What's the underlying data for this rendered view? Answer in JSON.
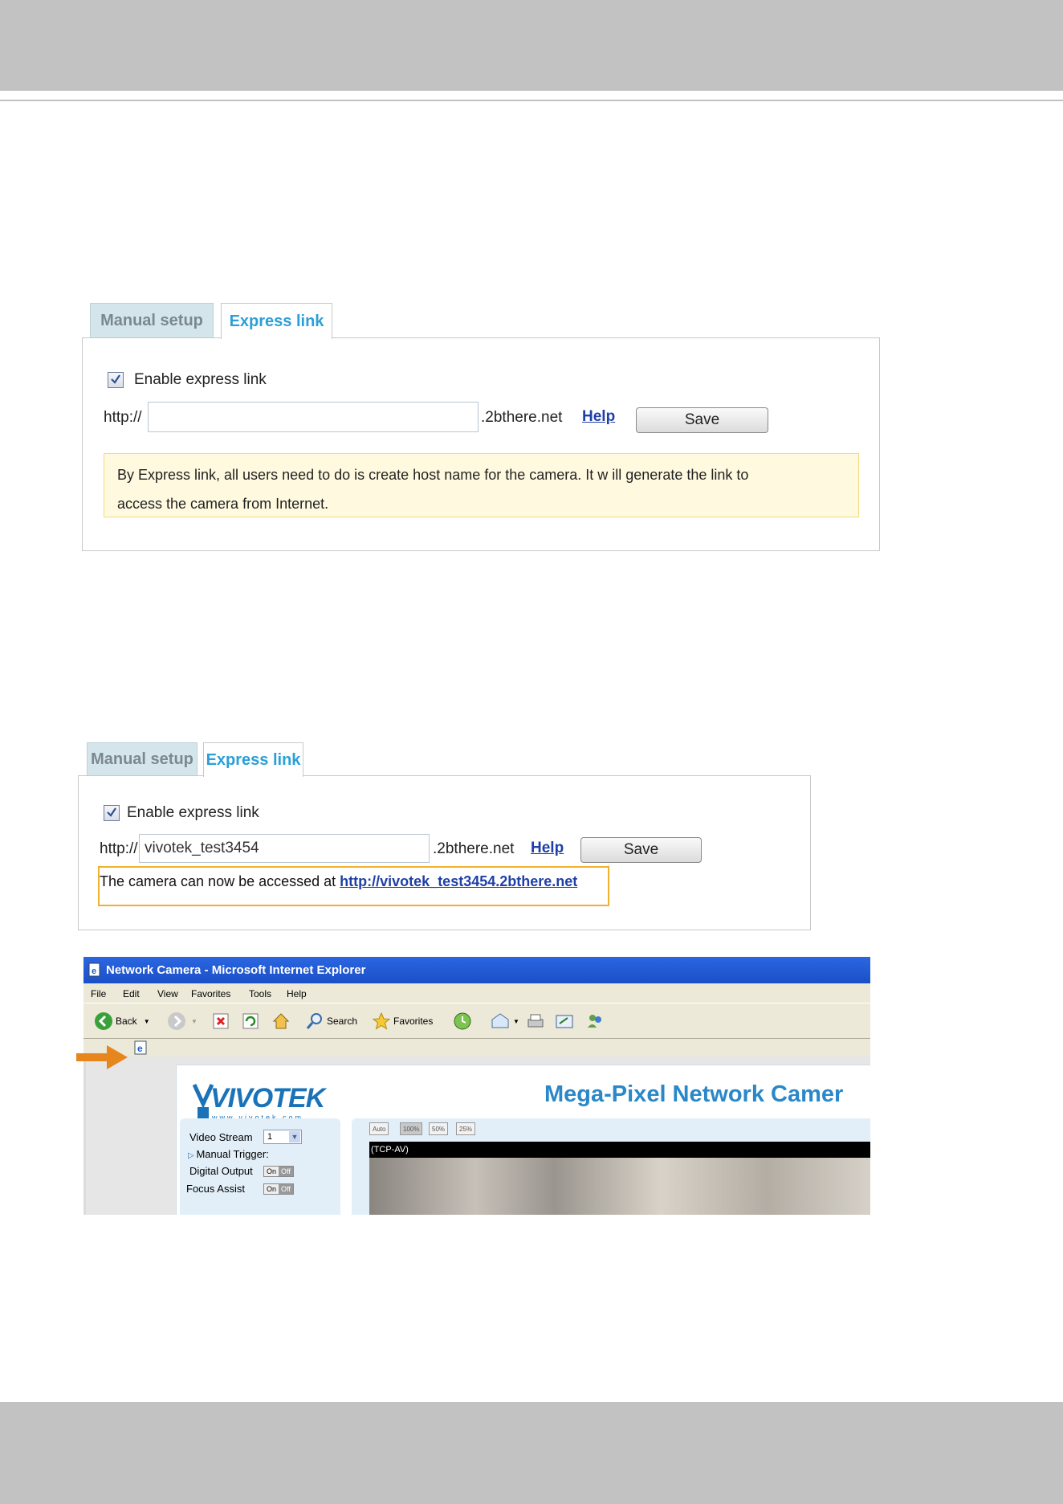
{
  "panel1": {
    "tabs": [
      "Manual setup",
      "Express link"
    ],
    "enable_label": "Enable express link",
    "enabled": true,
    "prefix": "http://",
    "hostname_value": "",
    "suffix": ".2bthere.net",
    "help_label": "Help",
    "save_label": "Save",
    "note_line1": "By Express link, all users need to do is create host name for the camera. It w ill generate the link to",
    "note_line2": "access the camera from Internet."
  },
  "panel2": {
    "tabs": [
      "Manual setup",
      "Express link"
    ],
    "enable_label": "Enable express link",
    "enabled": true,
    "prefix": "http://",
    "hostname_value": "vivotek_test3454",
    "suffix": ".2bthere.net",
    "help_label": "Help",
    "save_label": "Save",
    "status_text": "The camera can now be accessed at ",
    "status_link": "http://vivotek_test3454.2bthere.net"
  },
  "browser": {
    "title": "Network Camera - Microsoft Internet Explorer",
    "menu": [
      "File",
      "Edit",
      "View",
      "Favorites",
      "Tools",
      "Help"
    ],
    "toolbar": {
      "back": "Back",
      "search": "Search",
      "favorites": "Favorites"
    },
    "page": {
      "logo": "VIVOTEK",
      "logo_sub": "www.vivotek.com",
      "title": "Mega-Pixel Network Camer",
      "video_stream_label": "Video Stream",
      "video_stream_value": "1",
      "manual_trigger_label": "Manual Trigger:",
      "digital_output_label": "Digital Output",
      "focus_assist_label": "Focus Assist",
      "on_label": "On",
      "off_label": "Off",
      "view_buttons": [
        "Auto",
        "100%",
        "50%",
        "25%"
      ],
      "stream_label": "(TCP-AV)"
    }
  },
  "colors": {
    "band": "#c1c2c1",
    "tab_active": "#2a9fd8",
    "link": "#1f3fa8",
    "note_bg": "#fffadf",
    "highlight": "#f0b030",
    "arrow": "#e8861e"
  }
}
